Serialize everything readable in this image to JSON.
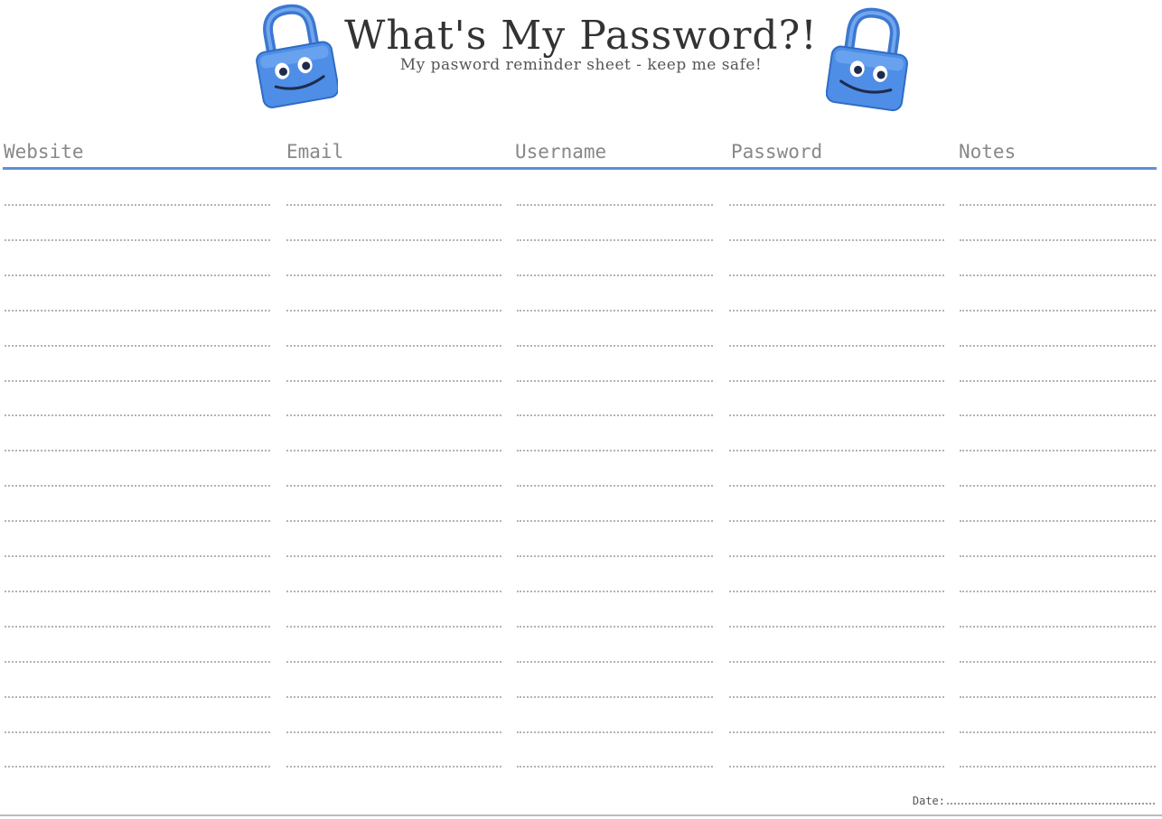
{
  "title": "What's My Password?!",
  "subtitle": "My pasword reminder sheet - keep me safe!",
  "columns": [
    "Website",
    "Email",
    "Username",
    "Password",
    "Notes"
  ],
  "date_label": "Date:",
  "accent_color": "#5b8fdb",
  "lock_color": "#4f8ee6",
  "icons": [
    "padlock-mascot-left",
    "padlock-mascot-right"
  ]
}
